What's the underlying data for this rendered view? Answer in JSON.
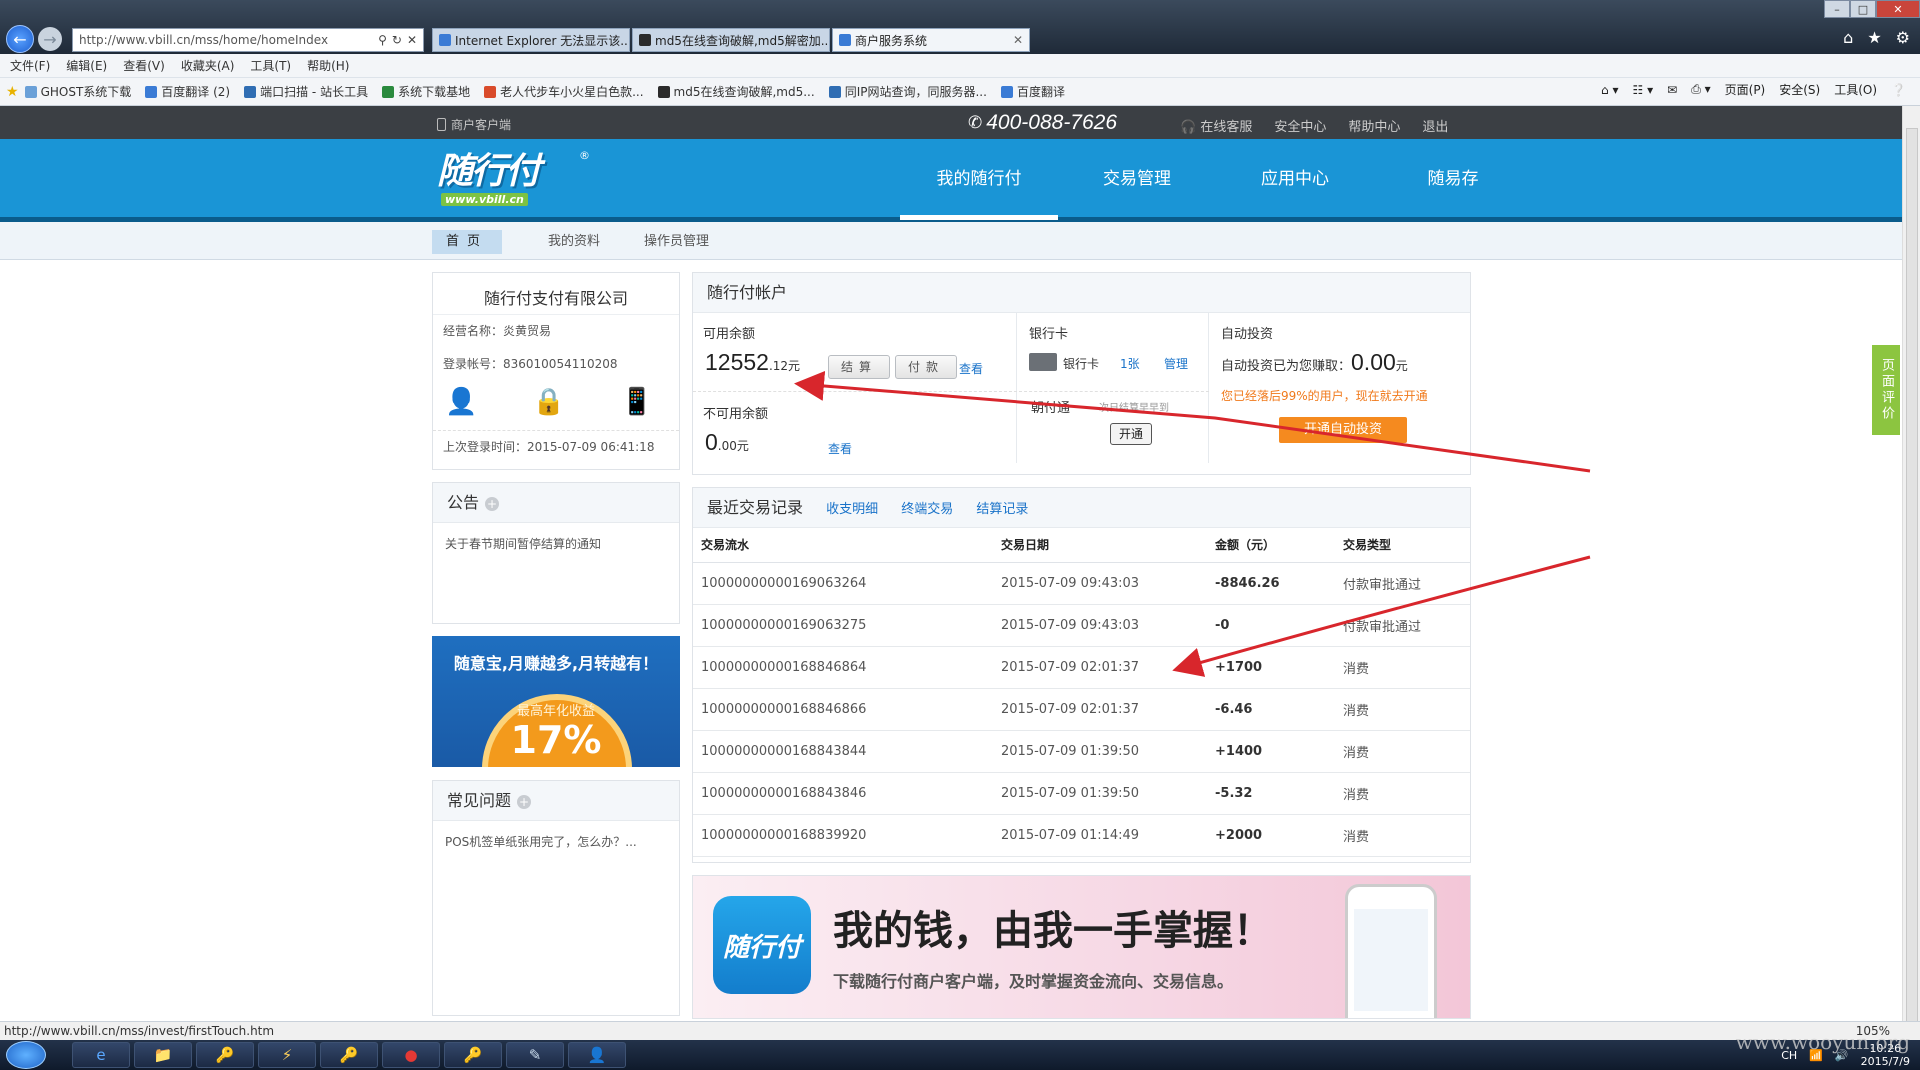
{
  "browser": {
    "url": "http://www.vbill.cn/mss/home/homeIndex",
    "tabs": [
      {
        "label": "Internet Explorer 无法显示该...",
        "color": "#3a7bd5"
      },
      {
        "label": "md5在线查询破解,md5解密加...",
        "color": "#2b2b2b"
      },
      {
        "label": "商户服务系统",
        "color": "#3a7bd5"
      }
    ],
    "menu": [
      "文件(F)",
      "编辑(E)",
      "查看(V)",
      "收藏夹(A)",
      "工具(T)",
      "帮助(H)"
    ],
    "favorites": [
      {
        "label": "GHOST系统下载",
        "color": "#6aa0d8"
      },
      {
        "label": "百度翻译 (2)",
        "color": "#3a7bd5"
      },
      {
        "label": "端口扫描 - 站长工具",
        "color": "#2f6db3"
      },
      {
        "label": "系统下载基地",
        "color": "#2a8a3e"
      },
      {
        "label": "老人代步车小火星白色款...",
        "color": "#d94b2b"
      },
      {
        "label": "md5在线查询破解,md5...",
        "color": "#2b2b2b"
      },
      {
        "label": "同IP网站查询，同服务器...",
        "color": "#2f6db3"
      },
      {
        "label": "百度翻译",
        "color": "#3a7bd5"
      }
    ],
    "commands": [
      "页面(P)",
      "安全(S)",
      "工具(O)"
    ],
    "status_url": "http://www.vbill.cn/mss/invest/firstTouch.htm",
    "zoom": "105%"
  },
  "topbar": {
    "client_label": "商户客户端",
    "hotline": "400-088-7626",
    "links": {
      "service": "在线客服",
      "security": "安全中心",
      "help": "帮助中心",
      "logout": "退出"
    }
  },
  "header": {
    "logo_text": "随行付",
    "logo_url": "www.vbill.cn",
    "nav": [
      "我的随行付",
      "交易管理",
      "应用中心",
      "随易存"
    ]
  },
  "subnav": [
    "首页",
    "我的资料",
    "操作员管理"
  ],
  "company": {
    "name": "随行付支付有限公司",
    "business_name": "经营名称：炎黄贸易",
    "login_account": "登录帐号：836010054110208",
    "last_login": "上次登录时间：2015-07-09 06:41:18"
  },
  "notice": {
    "title": "公告",
    "item": "关于春节期间暂停结算的通知"
  },
  "promo": {
    "headline": "随意宝,月赚越多,月转越有！",
    "sub": "最高年化收益",
    "rate": "17%"
  },
  "faq": {
    "title": "常见问题",
    "item": "POS机签单纸张用完了，怎么办？..."
  },
  "account": {
    "title": "随行付帐户",
    "available_label": "可用余额",
    "available_int": "12552",
    "available_dec": ".12元",
    "settle_btn": "结算",
    "pay_btn": "付款",
    "view": "查看",
    "unavailable_label": "不可用余额",
    "unavailable_int": "0",
    "unavailable_dec": ".00元",
    "bank_label": "银行卡",
    "bank_card": "银行卡",
    "bank_count": "1张",
    "bank_manage": "管理",
    "chaofu_label": "朝付通",
    "chaofu_note": "次日结算早早到",
    "open_btn": "开通",
    "autoinvest_label": "自动投资",
    "autoinvest_earned": "自动投资已为您赚取：",
    "autoinvest_int": "0.00",
    "autoinvest_unit": "元",
    "autoinvest_tip": "您已经落后99%的用户，现在就去开通",
    "autoinvest_btn": "开通自动投资"
  },
  "trades": {
    "title": "最近交易记录",
    "links": [
      "收支明细",
      "终端交易",
      "结算记录"
    ],
    "columns": [
      "交易流水",
      "交易日期",
      "金额（元）",
      "交易类型"
    ],
    "rows": [
      [
        "10000000000169063264",
        "2015-07-09 09:43:03",
        "-8846.26",
        "付款审批通过"
      ],
      [
        "10000000000169063275",
        "2015-07-09 09:43:03",
        "-0",
        "付款审批通过"
      ],
      [
        "10000000000168846864",
        "2015-07-09 02:01:37",
        "+1700",
        "消费"
      ],
      [
        "10000000000168846866",
        "2015-07-09 02:01:37",
        "-6.46",
        "消费"
      ],
      [
        "10000000000168843844",
        "2015-07-09 01:39:50",
        "+1400",
        "消费"
      ],
      [
        "10000000000168843846",
        "2015-07-09 01:39:50",
        "-5.32",
        "消费"
      ],
      [
        "10000000000168839920",
        "2015-07-09 01:14:49",
        "+2000",
        "消费"
      ]
    ]
  },
  "banner": {
    "app_name": "随行付",
    "headline": "我的钱，由我一手掌握！",
    "sub": "下载随行付商户客户端，及时掌握资金流向、交易信息。"
  },
  "side_tab": "页面评价",
  "taskbar": {
    "time": "10:26",
    "date": "2015/7/9",
    "ime": "CH"
  },
  "watermark": "www.wooyun.org",
  "colors": {
    "brand_blue": "#1a95d6",
    "topbar": "#3b3f44",
    "accent_orange": "#f39a1c",
    "arrow_red": "#d8262c"
  }
}
